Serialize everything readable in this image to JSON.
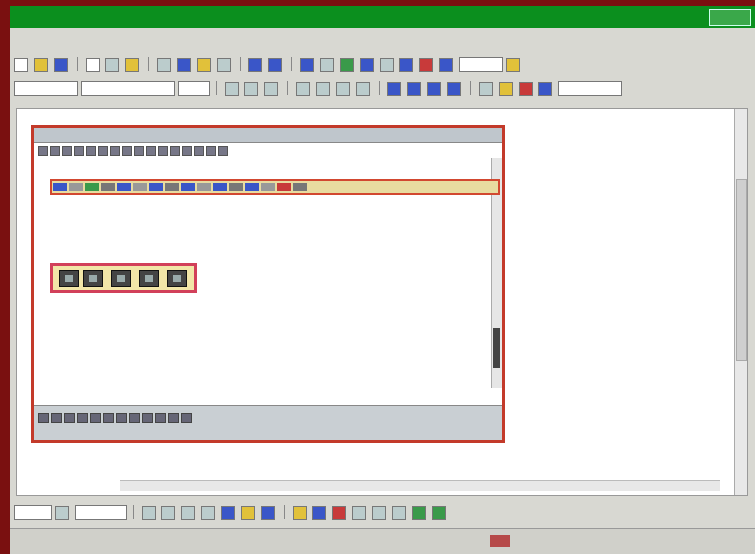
{
  "window": {
    "title": "",
    "controls": ""
  },
  "menu": [
    "",
    "",
    "",
    "",
    "",
    "",
    "",
    "",
    "",
    ""
  ],
  "toolbar": {
    "font_name": "",
    "font_size": ""
  },
  "document": {
    "caption_label": "",
    "body_paragraph": "",
    "toolbar_caption": "",
    "bottom_paragraph": "",
    "below_label": "",
    "below_sub": "",
    "below_note": ""
  },
  "colors": {
    "titlebar": "#0b8f1e",
    "frame": "#7a1010",
    "highlight_border": "#c33a2a",
    "highlight_fill": "#e8dca0"
  },
  "icons": [
    "new-icon",
    "open-icon",
    "save-icon",
    "print-icon",
    "cut-icon",
    "copy-icon",
    "paste-icon",
    "undo-icon",
    "redo-icon",
    "link-icon",
    "table-icon",
    "bold-icon",
    "italic-icon",
    "underline-icon",
    "align-left-icon",
    "align-center-icon",
    "align-right-icon",
    "bullets-icon",
    "numbering-icon",
    "indent-icon",
    "highlight-icon",
    "font-color-icon"
  ]
}
